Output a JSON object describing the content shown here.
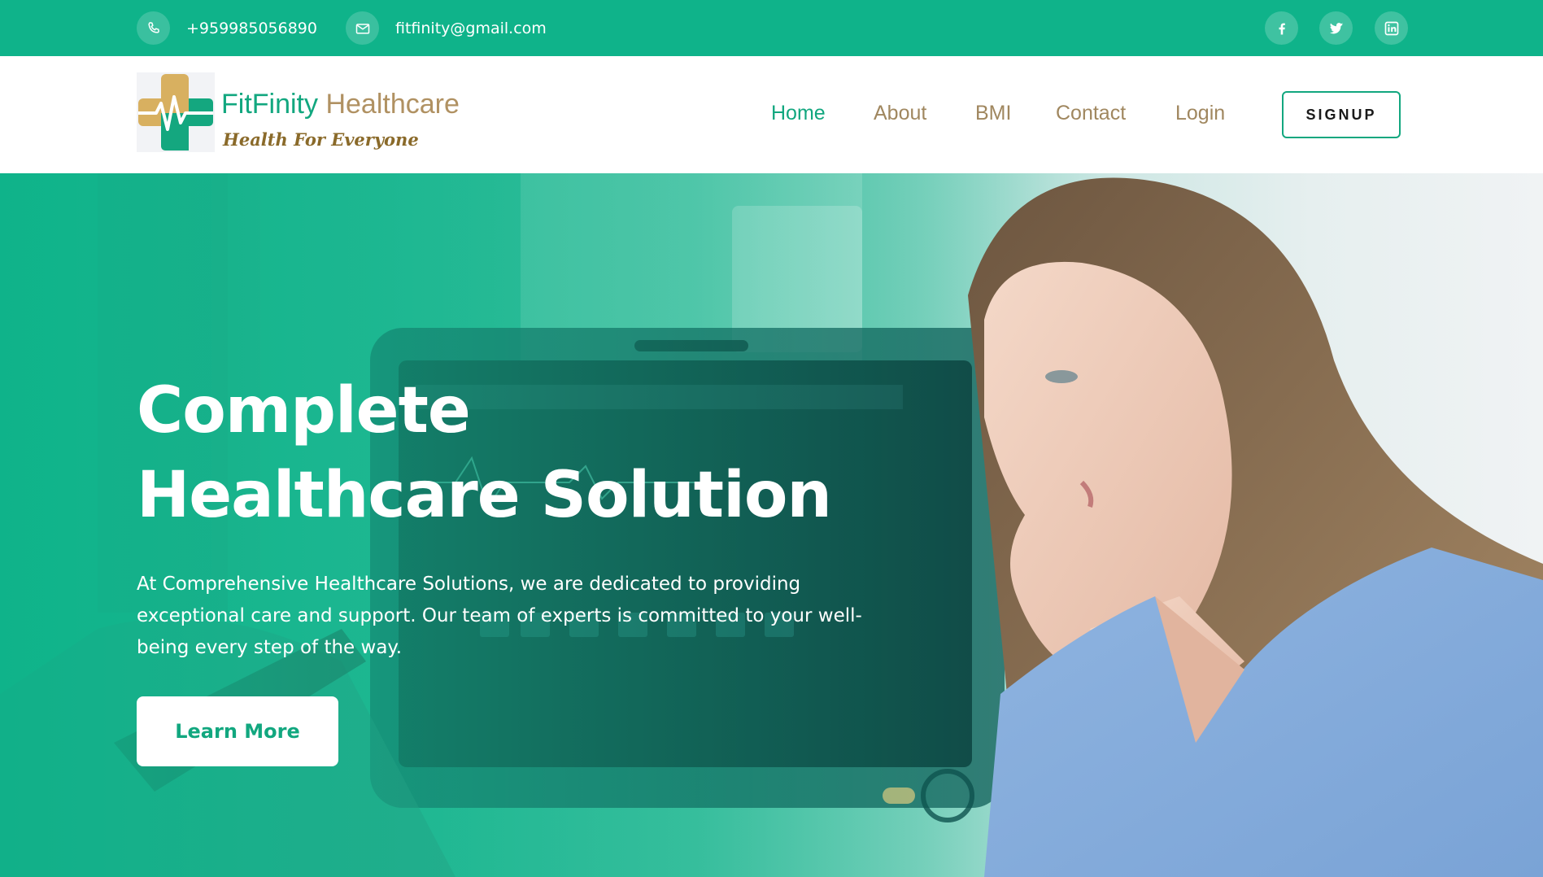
{
  "topbar": {
    "phone": "+959985056890",
    "email": "fitfinity@gmail.com",
    "phone_icon": "phone-icon",
    "email_icon": "mail-icon",
    "social": [
      "facebook-icon",
      "twitter-icon",
      "linkedin-icon"
    ]
  },
  "header": {
    "brand_part1": "FitFinity",
    "brand_part2": "Healthcare",
    "tagline": "Health For Everyone",
    "nav": {
      "home": "Home",
      "about": "About",
      "bmi": "BMI",
      "contact": "Contact",
      "login": "Login"
    },
    "signup_label": "SIGNUP"
  },
  "hero": {
    "title_line1": "Complete",
    "title_line2": "Healthcare Solution",
    "description": "At Comprehensive Healthcare Solutions, we are dedicated to providing exceptional care and support. Our team of experts is committed to your well-being every step of the way.",
    "cta_label": "Learn More"
  },
  "colors": {
    "brand_green": "#0fb38a",
    "brand_gold": "#b09162",
    "white": "#ffffff"
  }
}
